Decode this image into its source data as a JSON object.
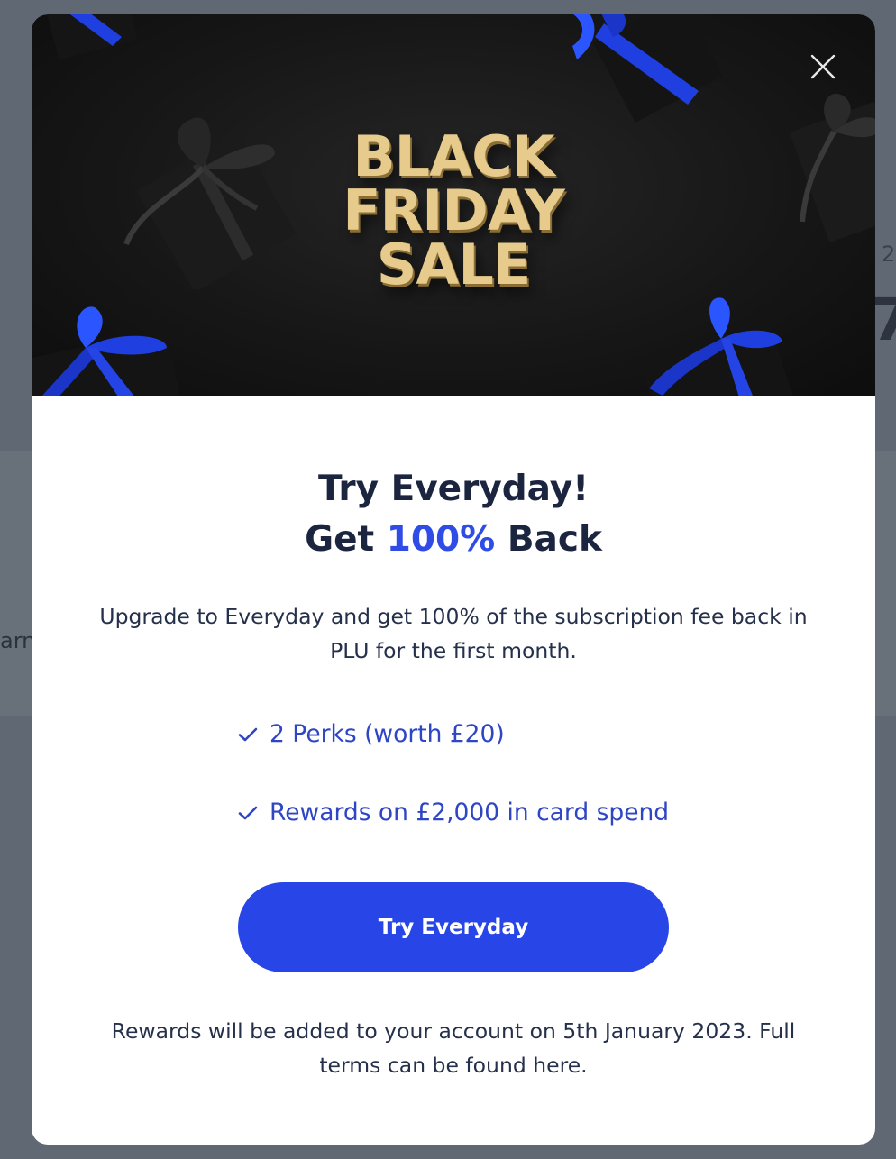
{
  "background": {
    "fragment_number_small": "2",
    "fragment_number_big": "7",
    "fragment_word": "arn"
  },
  "banner": {
    "headline_lines": [
      "BLACK",
      "FRIDAY",
      "SALE"
    ],
    "colors": {
      "headline": "#e6cb8d",
      "background": "#171717",
      "ribbon": "#1f3fe0"
    }
  },
  "modal": {
    "close_icon": "close-icon",
    "title_line1": "Try Everyday!",
    "title_line2_prefix": "Get ",
    "title_line2_accent": "100%",
    "title_line2_suffix": " Back",
    "description": "Upgrade to Everyday and get 100% of the subscription fee back in PLU for the first month.",
    "perks": [
      {
        "icon": "check-icon",
        "label": "2 Perks (worth £20)"
      },
      {
        "icon": "check-icon",
        "label": "Rewards on £2,000 in card spend"
      }
    ],
    "cta_label": "Try Everyday",
    "footnote": "Rewards will be added to your account on 5th January 2023. Full terms can be found here.",
    "colors": {
      "accent": "#2f4ce6",
      "button": "#2846e8",
      "text": "#1c2540"
    }
  }
}
